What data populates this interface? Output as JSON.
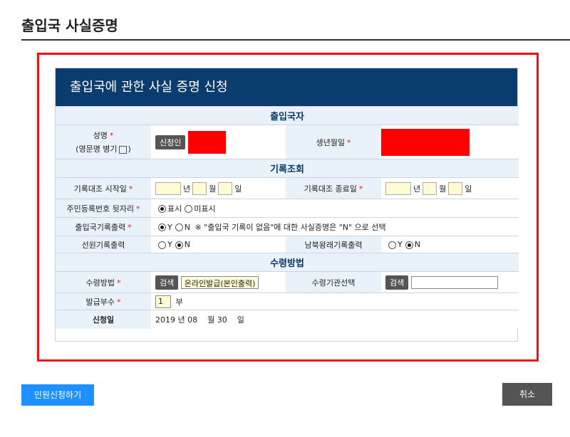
{
  "page": {
    "title": "출입국 사실증명"
  },
  "form": {
    "header": "출입국에 관한 사실 증명 신청",
    "sections": {
      "applicant": "출입국자",
      "records": "기록조회",
      "receipt": "수령방법"
    },
    "applicant": {
      "name_label": "성명",
      "english_name_label_prefix": "(영문명 병기",
      "english_name_label_suffix": ")",
      "applicant_button": "신청인",
      "birth_label": "생년월일"
    },
    "records": {
      "start_label": "기록대조 시작일",
      "end_label": "기록대조 종료일",
      "unit_year": "년",
      "unit_month": "월",
      "unit_day": "일",
      "id_suffix_label": "주민등록번호 뒷자리",
      "id_show": "표시",
      "id_hide": "미표시",
      "immigration_label": "출입국기록출력",
      "opt_y": "Y",
      "opt_n": "N",
      "immigration_note": "※ \"출입국 기록이 없음\"에 대한 사실증명은 \"N\" 으로 선택",
      "crew_label": "선원기록출력",
      "interkorean_label": "남북왕래기록출력"
    },
    "receipt": {
      "method_label": "수령방법",
      "search_button": "검색",
      "method_value": "온라인발급(본인출력)",
      "agency_label": "수령기관선택",
      "copies_label": "발급부수",
      "copies_value": "1",
      "copies_unit": "부",
      "date_label": "신청일",
      "date_value": "2019 년 08    월 30    일"
    },
    "required_mark": "*"
  },
  "actions": {
    "apply": "민원신청하기",
    "cancel": "취소"
  },
  "colors": {
    "header_bg": "#0b3c6e",
    "frame": "#ee1111",
    "apply_bg": "#1e90ff",
    "cancel_bg": "#555555"
  }
}
